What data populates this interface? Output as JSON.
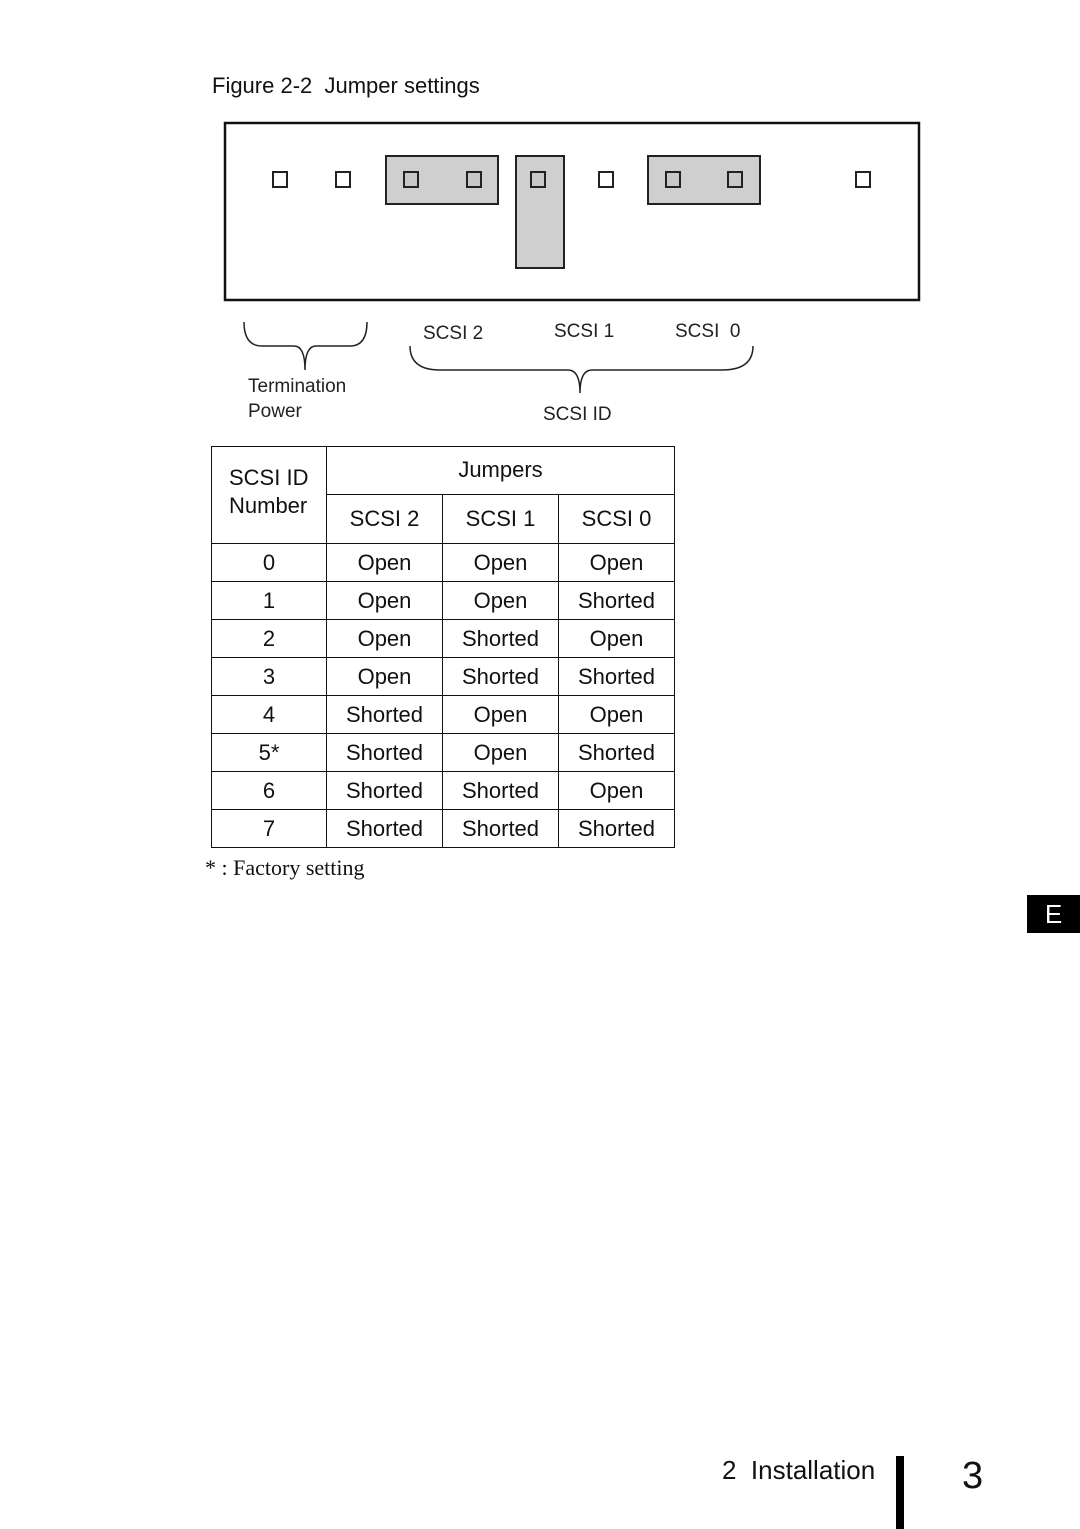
{
  "figure": {
    "title": "Figure 2-2  Jumper settings",
    "board": {
      "pins": [
        "pin",
        "pin",
        "pin",
        "pin",
        "pin",
        "pin",
        "pin",
        "pin",
        "pin"
      ],
      "jumper_caps": [
        "termination-power-shorted",
        "scsi2-shorted",
        "scsi0-shorted"
      ]
    },
    "labels": {
      "termination": "Termination",
      "power": "Power",
      "scsi2": "SCSI 2",
      "scsi1": "SCSI 1",
      "scsi0": "SCSI  0",
      "scsi_id": "SCSI ID"
    }
  },
  "table": {
    "id_header_line1": "SCSI ID",
    "id_header_line2": "Number",
    "jumpers_header": "Jumpers",
    "columns": [
      "SCSI 2",
      "SCSI 1",
      "SCSI 0"
    ],
    "rows": [
      {
        "id": "0",
        "values": [
          "Open",
          "Open",
          "Open"
        ]
      },
      {
        "id": "1",
        "values": [
          "Open",
          "Open",
          "Shorted"
        ]
      },
      {
        "id": "2",
        "values": [
          "Open",
          "Shorted",
          "Open"
        ]
      },
      {
        "id": "3",
        "values": [
          "Open",
          "Shorted",
          "Shorted"
        ]
      },
      {
        "id": "4",
        "values": [
          "Shorted",
          "Open",
          "Open"
        ]
      },
      {
        "id": "5*",
        "values": [
          "Shorted",
          "Open",
          "Shorted"
        ]
      },
      {
        "id": "6",
        "values": [
          "Shorted",
          "Shorted",
          "Open"
        ]
      },
      {
        "id": "7",
        "values": [
          "Shorted",
          "Shorted",
          "Shorted"
        ]
      }
    ],
    "footnote": "* : Factory setting"
  },
  "side_tab": "E",
  "footer": {
    "section": "2  Installation",
    "page_number": "3"
  }
}
